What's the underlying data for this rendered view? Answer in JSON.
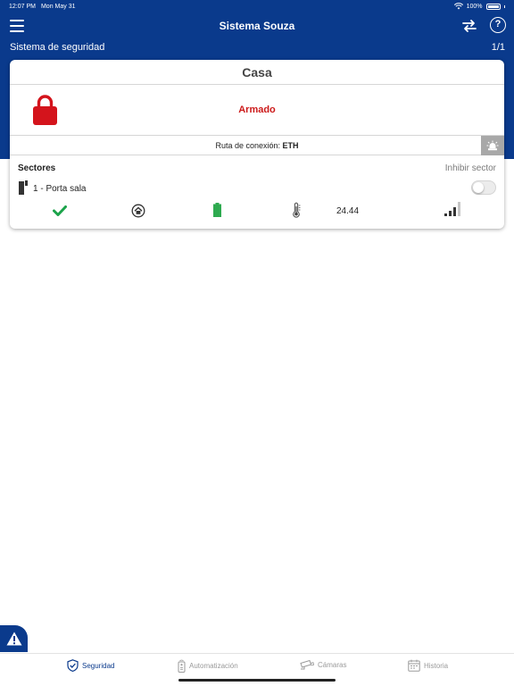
{
  "status_bar": {
    "time": "12:07 PM",
    "date": "Mon May 31",
    "battery": "100%"
  },
  "nav": {
    "title": "Sistema Souza"
  },
  "section": {
    "title": "Sistema de seguridad",
    "page_count": "1/1"
  },
  "card": {
    "name": "Casa",
    "status": "Armado",
    "route_label": "Ruta de conexión: ",
    "route_value": "ETH",
    "sectores_label": "Sectores",
    "inhibit_label": "Inhibir sector",
    "sector": {
      "name": "1 - Porta sala",
      "inhibited": false,
      "temperature": "24.44",
      "signal_bars_active": 3,
      "signal_bars_total": 4
    }
  },
  "colors": {
    "brand_blue": "#0a3a8c",
    "armed_red": "#cc1a1a",
    "ok_green": "#1ba34a",
    "battery_green": "#2eaa4f"
  },
  "tabs": [
    {
      "label": "Seguridad",
      "icon": "shield-check-icon",
      "active": true
    },
    {
      "label": "Automatización",
      "icon": "remote-icon",
      "active": false
    },
    {
      "label": "Cámaras",
      "icon": "camera-icon",
      "active": false
    },
    {
      "label": "Historia",
      "icon": "calendar-icon",
      "active": false
    }
  ]
}
